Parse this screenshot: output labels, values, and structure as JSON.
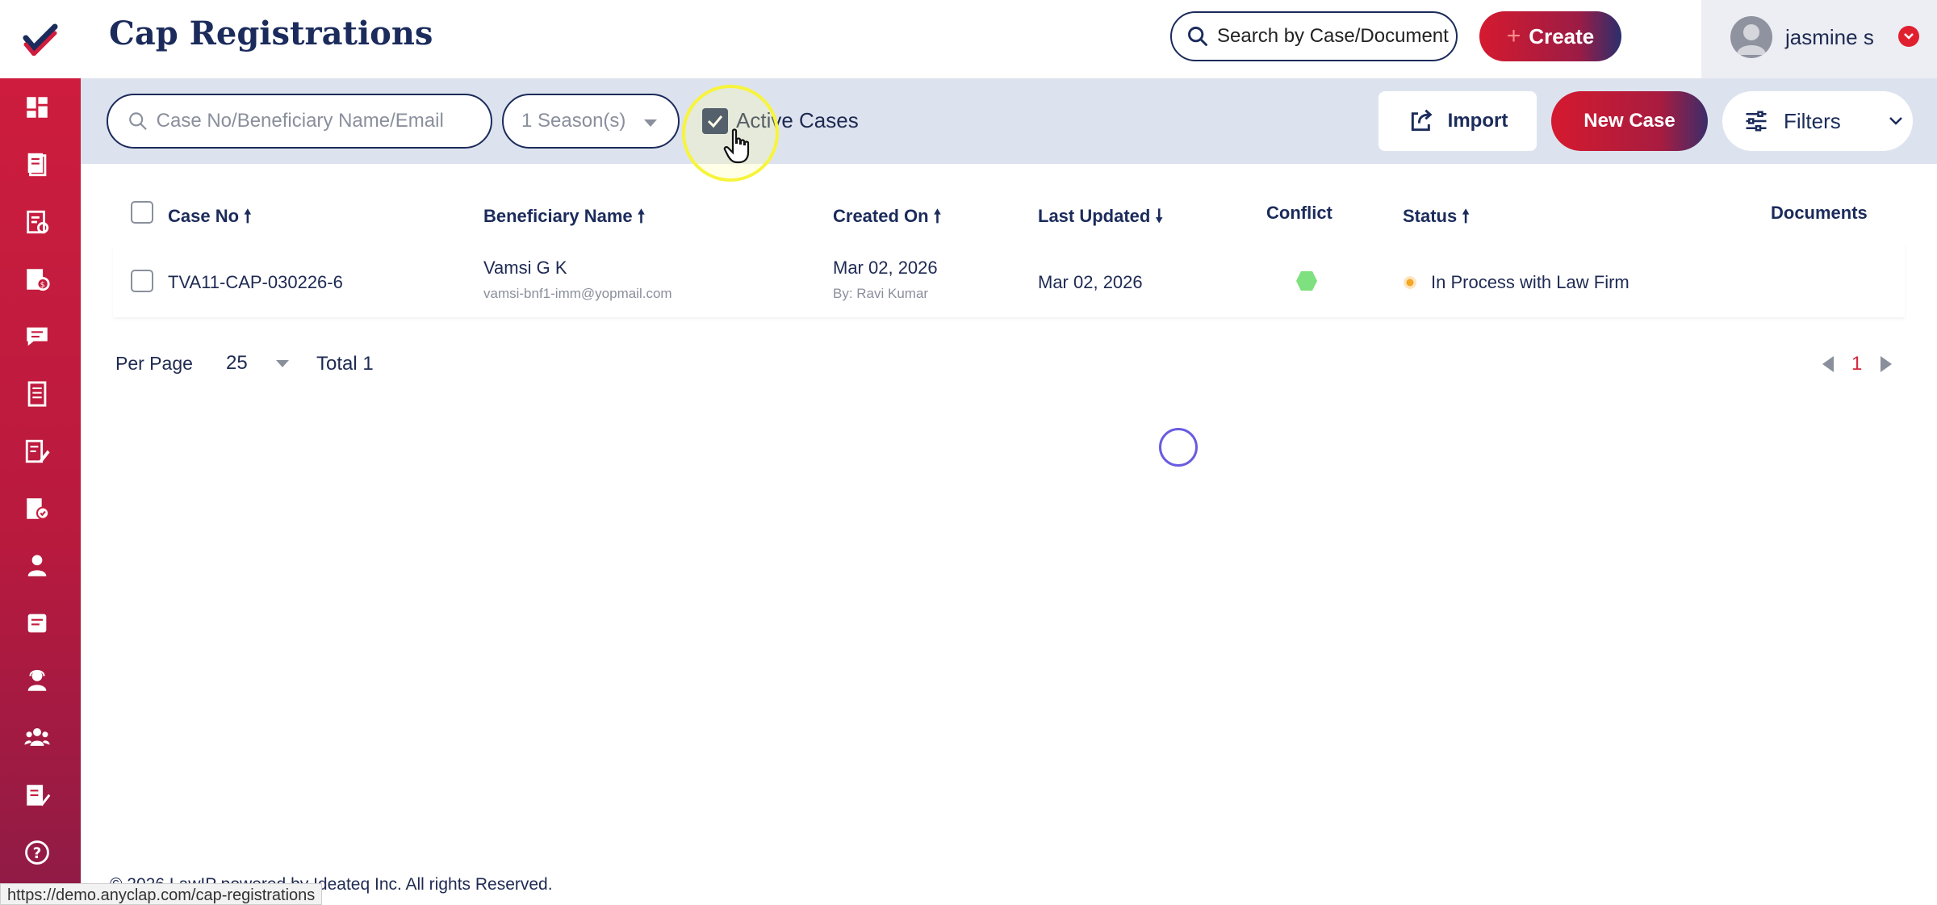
{
  "header": {
    "title": "Cap Registrations",
    "search_placeholder": "Search by Case/Document",
    "create_label": "Create",
    "user_name": "jasmine s"
  },
  "filters": {
    "case_search_placeholder": "Case No/Beneficiary Name/Email",
    "season_value": "1 Season(s)",
    "active_cases_label": "Active Cases",
    "active_cases_checked": true,
    "import_label": "Import",
    "new_case_label": "New Case",
    "filters_label": "Filters"
  },
  "table": {
    "columns": {
      "case_no": "Case No",
      "beneficiary_name": "Beneficiary Name",
      "created_on": "Created On",
      "last_updated": "Last Updated",
      "conflict": "Conflict",
      "status": "Status",
      "documents": "Documents"
    },
    "rows": [
      {
        "case_no": "TVA11-CAP-030226-6",
        "beneficiary_name": "Vamsi G K",
        "beneficiary_email": "vamsi-bnf1-imm@yopmail.com",
        "created_on": "Mar 02, 2026",
        "created_by": "By: Ravi Kumar",
        "last_updated": "Mar 02, 2026",
        "conflict_color": "#7ee07e",
        "status": "In Process with Law Firm",
        "status_color": "#f5a623"
      }
    ]
  },
  "pagination": {
    "per_page_label": "Per Page",
    "per_page_value": "25",
    "total_label": "Total 1",
    "current_page": "1"
  },
  "footer": {
    "text": "© 2026 LawIP powered by Ideateq Inc. All rights Reserved."
  },
  "status_bar_url": "https://demo.anyclap.com/cap-registrations",
  "colors": {
    "brand_red": "#d11d3d",
    "navy": "#1b2b5b",
    "filter_bar": "#dde3ee"
  }
}
